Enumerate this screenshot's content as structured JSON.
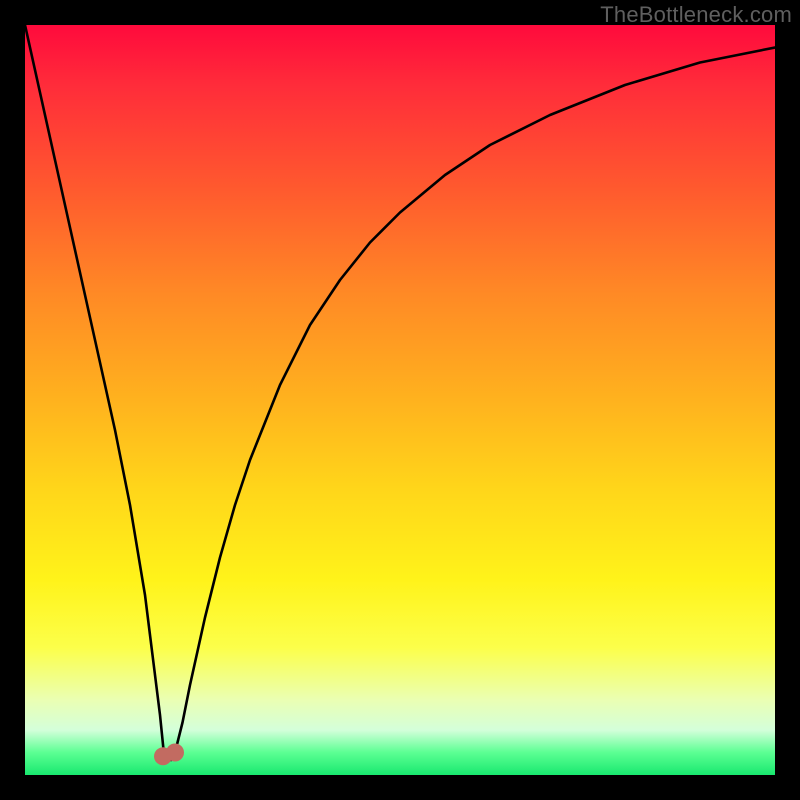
{
  "watermark": "TheBottleneck.com",
  "chart_data": {
    "type": "line",
    "title": "",
    "xlabel": "",
    "ylabel": "",
    "xlim": [
      0,
      100
    ],
    "ylim": [
      0,
      100
    ],
    "series": [
      {
        "name": "bottleneck-curve",
        "x": [
          0,
          2,
          4,
          6,
          8,
          10,
          12,
          14,
          16,
          17,
          18,
          18.5,
          19,
          19.5,
          20,
          21,
          22,
          24,
          26,
          28,
          30,
          34,
          38,
          42,
          46,
          50,
          56,
          62,
          70,
          80,
          90,
          100
        ],
        "values": [
          100,
          91,
          82,
          73,
          64,
          55,
          46,
          36,
          24,
          16,
          8,
          3,
          2,
          2,
          3,
          7,
          12,
          21,
          29,
          36,
          42,
          52,
          60,
          66,
          71,
          75,
          80,
          84,
          88,
          92,
          95,
          97
        ]
      }
    ],
    "markers": [
      {
        "name": "minimum-left",
        "x": 18.4,
        "y": 2.5,
        "color": "#c26b61"
      },
      {
        "name": "minimum-right",
        "x": 20.0,
        "y": 3.0,
        "color": "#c26b61"
      }
    ],
    "colors": {
      "curve": "#000000",
      "marker": "#c26b61"
    }
  }
}
